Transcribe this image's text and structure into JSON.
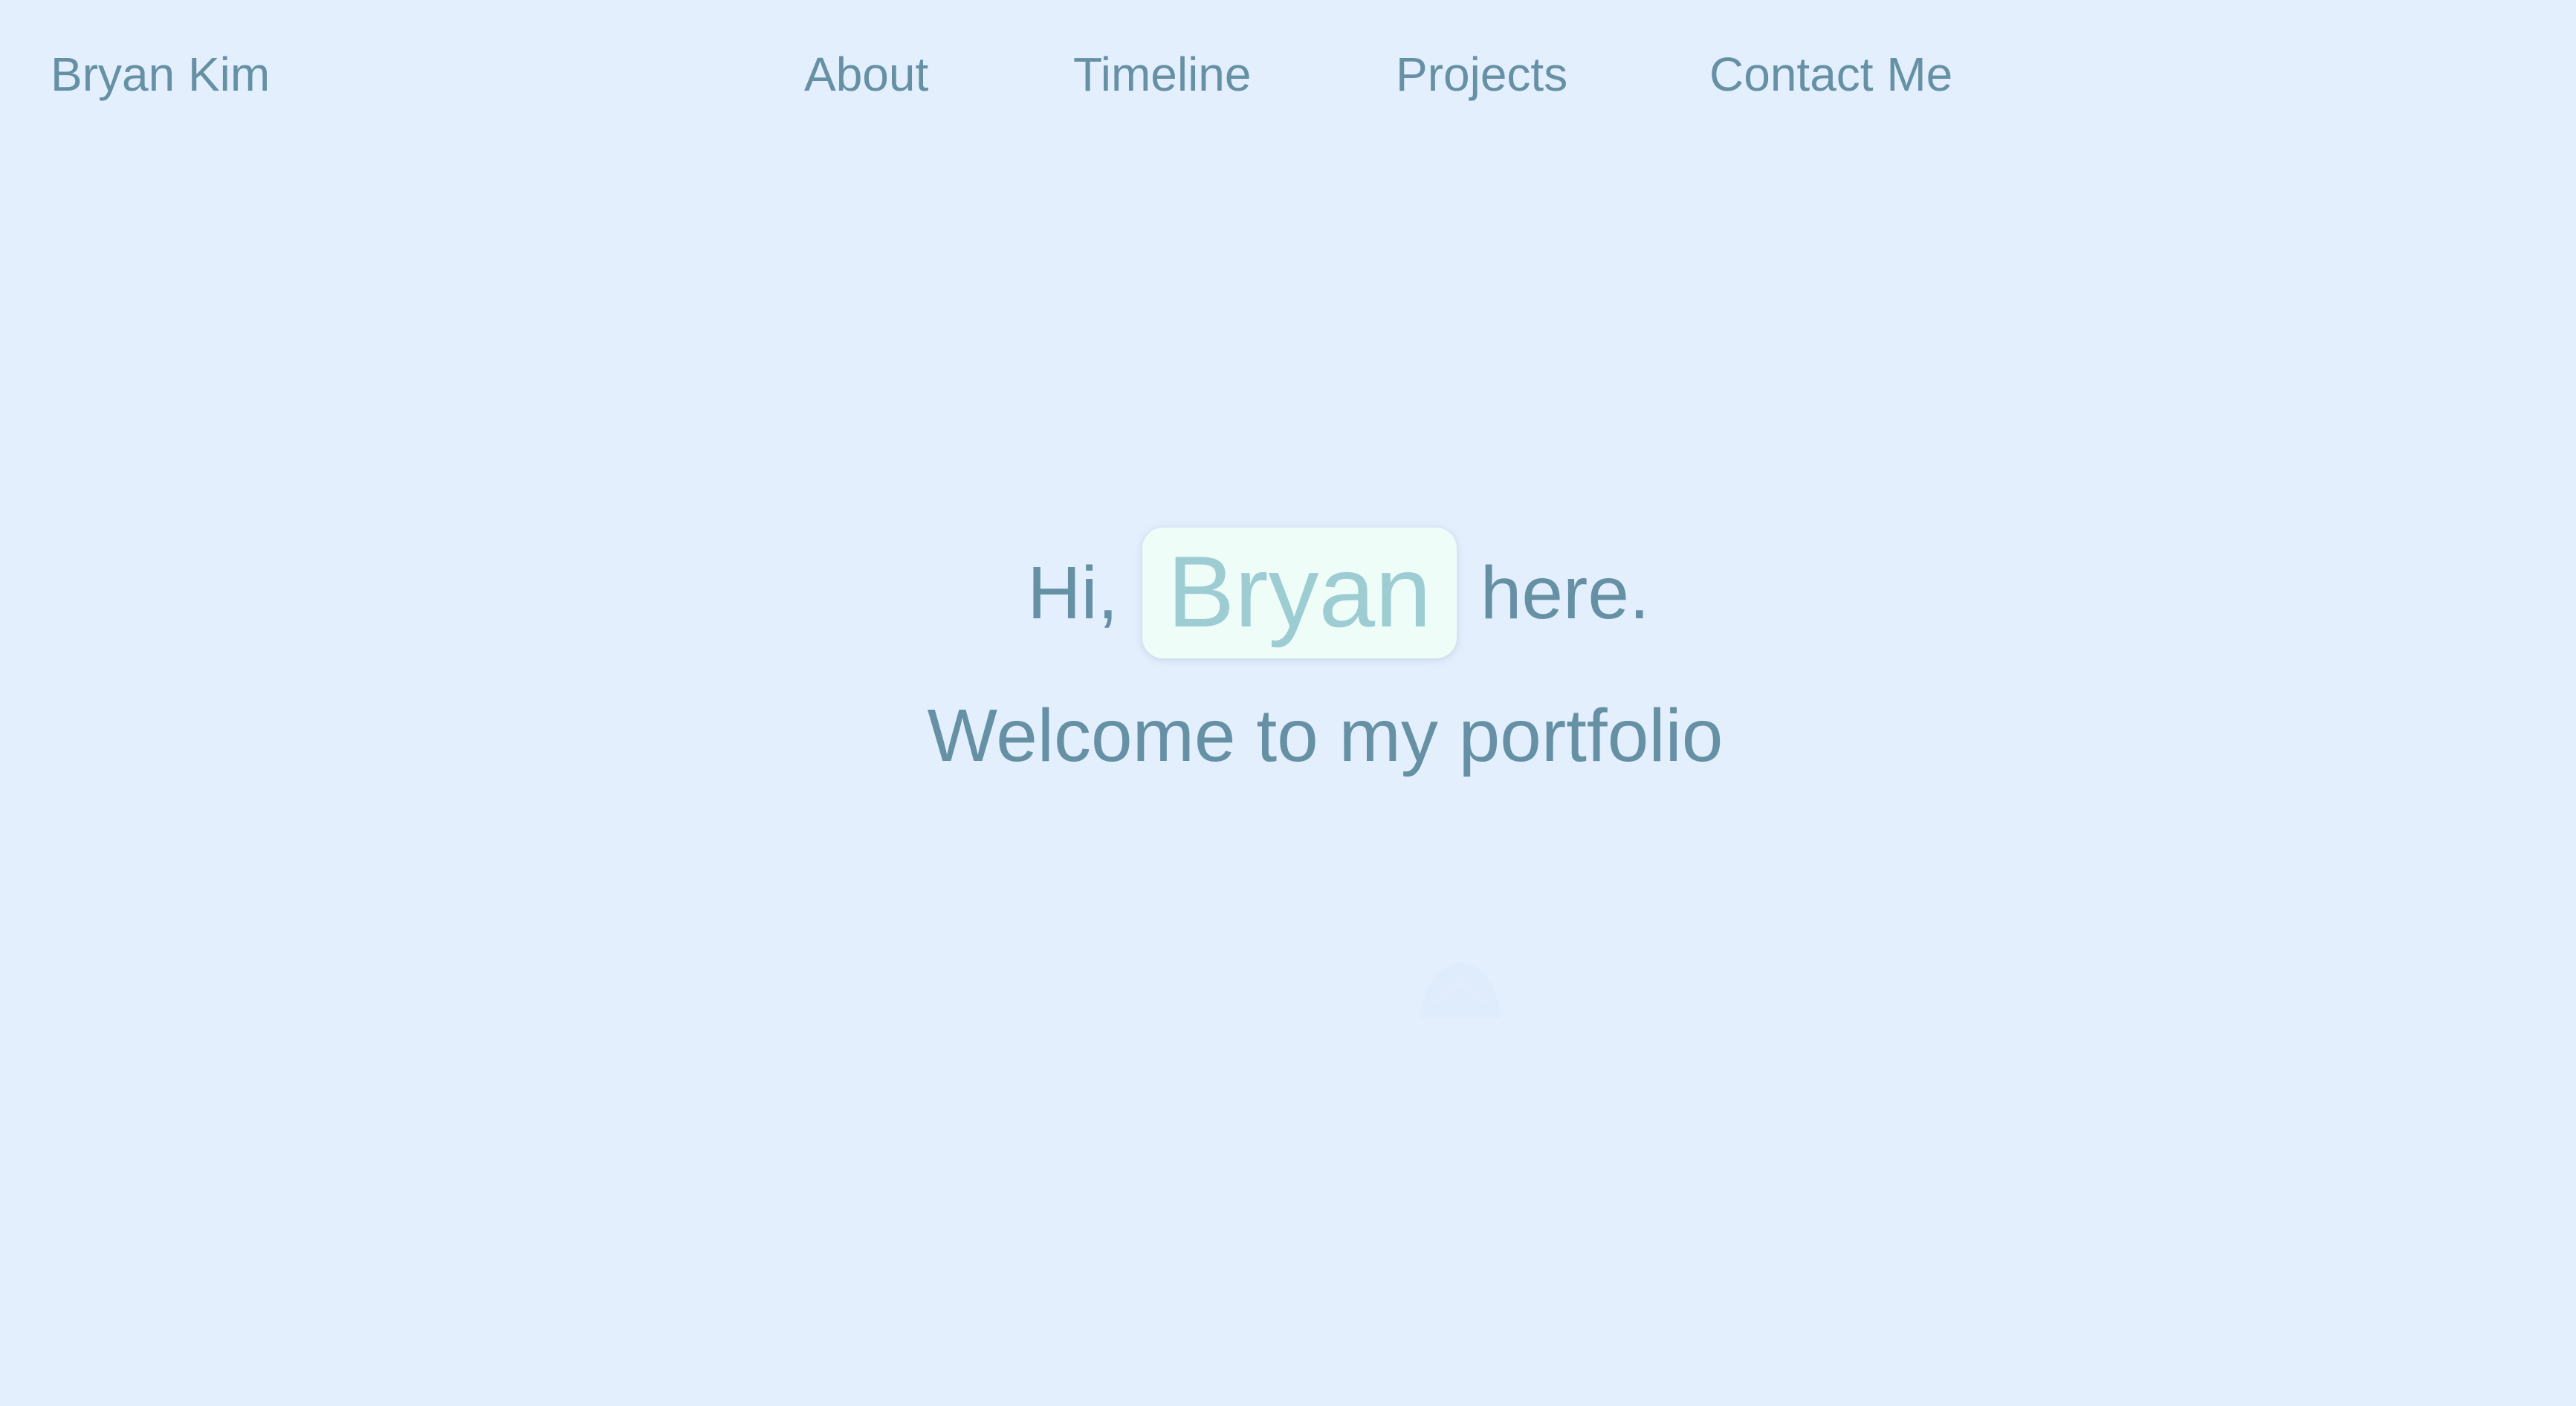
{
  "header": {
    "brand": "Bryan Kim",
    "nav": [
      {
        "label": "About"
      },
      {
        "label": "Timeline"
      },
      {
        "label": "Projects"
      },
      {
        "label": "Contact Me"
      }
    ]
  },
  "hero": {
    "greeting_prefix": "Hi,",
    "name": "Bryan",
    "greeting_suffix": "here.",
    "subtitle": "Welcome to my portfolio"
  },
  "icons": {
    "scroll_hint": "faded-shape-icon"
  },
  "colors": {
    "background": "#e3effd",
    "text": "#6690a4",
    "accent_text": "#9dccd2",
    "accent_box": "#effdf9"
  }
}
